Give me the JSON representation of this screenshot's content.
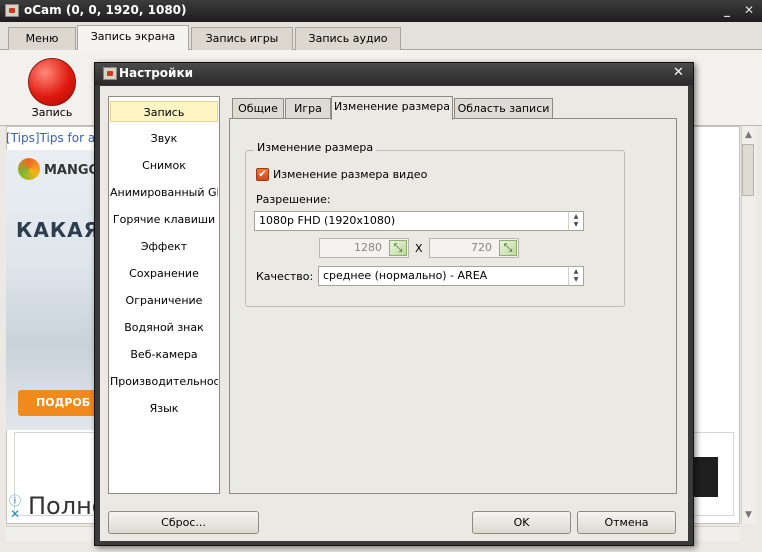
{
  "main_window": {
    "title": "oCam (0, 0, 1920, 1080)",
    "app_icon": "ocam-icon",
    "minimize": "_",
    "close": "✕",
    "tabs": [
      "Меню",
      "Запись экрана",
      "Запись игры",
      "Запись аудио"
    ],
    "active_tab": "Запись экрана",
    "record_button_label": "Запись"
  },
  "browser": {
    "tips_prefix": "[Tips]",
    "tips_text": "Tips for a",
    "ad_brand": "MANGO",
    "ad_headline": "КАКАЯ",
    "ad_cta": "ПОДРОБ",
    "ad2_info": "ⓘ",
    "ad2_close": "✕",
    "ad2_text": "Полно"
  },
  "dialog": {
    "title": "Настройки",
    "close": "✕",
    "nav_items": [
      "Запись",
      "Звук",
      "Снимок",
      "Анимированный GIF",
      "Горячие клавиши",
      "Эффект",
      "Сохранение",
      "Ограничение",
      "Водяной знак",
      "Веб-камера",
      "Производительность",
      "Язык"
    ],
    "selected_nav": "Запись",
    "tabs": [
      "Общие",
      "Игра",
      "Изменение размера",
      "Область записи"
    ],
    "active_tab": "Изменение размера",
    "group_title": "Изменение размера",
    "resize_checkbox": {
      "label": "Изменение размера видео",
      "checked": true
    },
    "resolution_label": "Разрешение:",
    "resolution_value": "1080p FHD (1920x1080)",
    "width_value": "1280",
    "height_value": "720",
    "x_separator": "X",
    "quality_label": "Качество:",
    "quality_value": "среднее (нормально) - AREA",
    "reset_button": "Сброс...",
    "ok_button": "OK",
    "cancel_button": "Отмена"
  }
}
